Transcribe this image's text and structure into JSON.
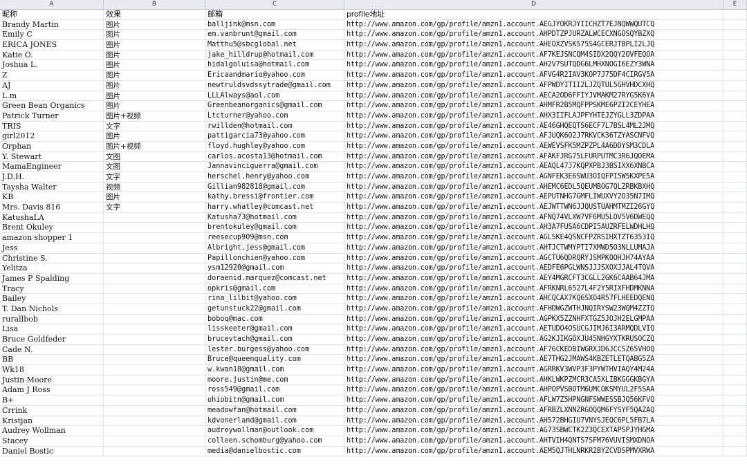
{
  "column_letters": [
    "A",
    "B",
    "C",
    "D",
    "E"
  ],
  "header_row": {
    "nickname": "昵称",
    "effect": "效果",
    "email": "邮箱",
    "profile": "profile地址"
  },
  "rows": [
    {
      "name": "Brandy Martin",
      "effect": "图片",
      "email": "balljink@msn.com",
      "profile": "http://www.amazon.com/gp/profile/amzn1.account.AEGJYOKRJYIICHZT7EJNQWWQUTCQ"
    },
    {
      "name": "Emily C",
      "effect": "图片",
      "email": "em.vanbrunt@gmail.com",
      "profile": "http://www.amazon.com/gp/profile/amzn1.account.AHPDTZPJURZALWCECXNGOSQYBZXQ"
    },
    {
      "name": "ERICA JONES",
      "effect": "图片",
      "email": "Matthu5@sbcglobal.net",
      "profile": "http://www.amazon.com/gp/profile/amzn1.account.AHEOXZVSK575S4GCERJTBPLI2LJQ"
    },
    {
      "name": "Katie O.",
      "effect": "图片",
      "email": "jake_hilldrup@hotmail.com",
      "profile": "http://www.amazon.com/gp/profile/amzn1.account.AF7KEJSNCQM4SIDX2QQY2OVFEQOA"
    },
    {
      "name": "Joshua L.",
      "effect": "图片",
      "email": "hidalgoluisa@hotmail.com",
      "profile": "http://www.amazon.com/gp/profile/amzn1.account.AH2V7SUTQDG6LMHXNOGI6EZY3WNA"
    },
    {
      "name": "Z",
      "effect": "图片",
      "email": "Ericaandmario@yahoo.com",
      "profile": "http://www.amazon.com/gp/profile/amzn1.account.AFVG4R2IAV3KOP7J75DF4CIRGV5A"
    },
    {
      "name": "AJ",
      "effect": "图片",
      "email": "newtruldsvdssytrade@gmail.com",
      "profile": "http://www.amazon.com/gp/profile/amzn1.account.AFPWDYITII2LJZQTUL5GHVHDCXHQ"
    },
    {
      "name": "L.m",
      "effect": "图片",
      "email": "LLLAlways@aol.com",
      "profile": "http://www.amazon.com/gp/profile/amzn1.account.AECA2OD6FFIYJVMAKM27RYG5K6YA"
    },
    {
      "name": "Green Bean Organics",
      "effect": "图片",
      "email": "Greenbeanorganics@gmail.com",
      "profile": "http://www.amazon.com/gp/profile/amzn1.account.AHMFR2B5MQFPPSKME6PZI2CEYHEA"
    },
    {
      "name": "Patrick Turner",
      "effect": "图片+视频",
      "email": "Ltcturner@yahoo.com",
      "profile": "http://www.amazon.com/gp/profile/amzn1.account.AHX3IIFLAJPFYHTEJZYGLL3ZDPAA"
    },
    {
      "name": "TRIS",
      "effect": "文字",
      "email": "rwillden@hotmail.com",
      "profile": "http://www.amazon.com/gp/profile/amzn1.account.AE46GHQEQTS6ECF7L7BSL4ML2JMQ"
    },
    {
      "name": "girl2012",
      "effect": "图片",
      "email": "pattigarcia73@yahoo.com",
      "profile": "http://www.amazon.com/gp/profile/amzn1.account.AFJUQK6O2J7RKVCK36TZYASCNFVQ"
    },
    {
      "name": "Orphan",
      "effect": "图片+视频",
      "email": "floyd.hughley@yahoo.com",
      "profile": "http://www.amazon.com/gp/profile/amzn1.account.AEWEVSFK5MZPZPL4A6DDYSM3CDLA"
    },
    {
      "name": "Y. Stewart",
      "effect": "文图",
      "email": "carlos.acosta13@hotmail.com",
      "profile": "http://www.amazon.com/gp/profile/amzn1.account.AFAKFJRG75LFURPUTMC3R6JQOEMA"
    },
    {
      "name": "MamaEngineer",
      "effect": "文图",
      "email": "Jannavinciguerra@gmail.com",
      "profile": "http://www.amazon.com/gp/profile/amzn1.account.AEAQL47J7KQPXPBJ3BSIXX6XNBCA"
    },
    {
      "name": "J.D.H.",
      "effect": "文字",
      "email": "herschel.henry@yahoo.com",
      "profile": "http://www.amazon.com/gp/profile/amzn1.account.AGNFEK3E6SWU3OIQFPI5W5KXPE5A"
    },
    {
      "name": "Taysha Walter",
      "effect": "视频",
      "email": "Gillian982818@gmail.com",
      "profile": "http://www.amazon.com/gp/profile/amzn1.account.AHEMC6EDL5QEUMBOG7QLZRBKBXHQ"
    },
    {
      "name": "KB",
      "effect": "图片",
      "email": "kathy.bressi@frontier.com",
      "profile": "http://www.amazon.com/gp/profile/amzn1.account.AEPUTNHG7GMFLIWUXVY2O35N7IMQ"
    },
    {
      "name": "Mrs. Davis 816",
      "effect": "文字",
      "email": "harry.whatley@comcast.net",
      "profile": "http://www.amazon.com/gp/profile/amzn1.account.AEJWTTWN6JJQUSTUAHMTMZI26GYQ"
    },
    {
      "name": "KatushaLA",
      "effect": "",
      "email": "Katusha73@hotmail.com",
      "profile": "http://www.amazon.com/gp/profile/amzn1.account.AFNQ74VLXW7VF6MU5LOV5V6DWEQQ"
    },
    {
      "name": "Brent Okuley",
      "effect": "",
      "email": "brentokuley@gmail.com",
      "profile": "http://www.amazon.com/gp/profile/amzn1.account.AH3A7FUSA6CDPI5AUZRFELWDHLHQ"
    },
    {
      "name": "amazon shopper 1",
      "effect": "",
      "email": "reesecup909@msn.com",
      "profile": "http://www.amazon.com/gp/profile/amzn1.account.AGLSKE4QSNCFPZRSIHXTZT6353IQ"
    },
    {
      "name": "Jess",
      "effect": "",
      "email": "Albright.jess@gmail.com",
      "profile": "http://www.amazon.com/gp/profile/amzn1.account.AHTJCTWMYPTI7XMWD5O3NLLUMAJA"
    },
    {
      "name": "Christine S.",
      "effect": "",
      "email": "Papillonchien@yahoo.com",
      "profile": "http://www.amazon.com/gp/profile/amzn1.account.AGCTU6QDRQRYJSMPKOOHJH74AYAA"
    },
    {
      "name": "Yelitza",
      "effect": "",
      "email": "ysm12920@gmail.com",
      "profile": "http://www.amazon.com/gp/profile/amzn1.account.AEDFE6PGLWNSJJJSXOXJJAL4TQVA"
    },
    {
      "name": "James P Spalding",
      "effect": "",
      "email": "doraenid.marquez@comcast.net",
      "profile": "http://www.amazon.com/gp/profile/amzn1.account.AEY4MGRCFT3CGLL2GK6CAAB64JMA"
    },
    {
      "name": "Tracy",
      "effect": "",
      "email": "opkris@gmail.com",
      "profile": "http://www.amazon.com/gp/profile/amzn1.account.AFRKNRL6527L4F2Y5RIXFHDMKNNA"
    },
    {
      "name": "Bailey",
      "effect": "",
      "email": "rina_lilbit@yahoo.com",
      "profile": "http://www.amazon.com/gp/profile/amzn1.account.AHCQCAX7KQ6SXO4R57FLHEEDQENQ"
    },
    {
      "name": "T. Dan Nichols",
      "effect": "",
      "email": "getunstuck22@gmail.com",
      "profile": "http://www.amazon.com/gp/profile/amzn1.account.AFHDWGZWTHJNQIRYSW23WQM4ZZTQ"
    },
    {
      "name": "rurallbob",
      "effect": "",
      "email": "boboq@mac.com",
      "profile": "http://www.amazon.com/gp/profile/amzn1.account.AGPKX5ZZNHFXTGZ5JOJH2ELGMPAA"
    },
    {
      "name": "Lisa",
      "effect": "",
      "email": "lisskeeter@gmail.com",
      "profile": "http://www.amazon.com/gp/profile/amzn1.account.AETUDO4OSUCGJIMJ6I3ARMQDLVIQ"
    },
    {
      "name": "Bruce Goldfeder",
      "effect": "",
      "email": "brucevtach@gmail.com",
      "profile": "http://www.amazon.com/gp/profile/amzn1.account.AG2KJIKGOXJU45NHGYXTKRUSOCZQ"
    },
    {
      "name": "Cade N.",
      "effect": "",
      "email": "lester.burgess@yahoo.com",
      "profile": "http://www.amazon.com/gp/profile/amzn1.account.AF76CKEDBIWGRXJD6JCCSZ65VHOQ"
    },
    {
      "name": "BB",
      "effect": "",
      "email": "Bruce@queenquality.com",
      "profile": "http://www.amazon.com/gp/profile/amzn1.account.AE7THG2JMAWS4KBZETLETQABG5ZA"
    },
    {
      "name": "Wk18",
      "effect": "",
      "email": "w.kwan18@gmail.com",
      "profile": "http://www.amazon.com/gp/profile/amzn1.account.AGRRKV3WVP3F3PYWTHVIAQY4M24A"
    },
    {
      "name": "Justin Moore",
      "effect": "",
      "email": "moore.justin@me.com",
      "profile": "http://www.amazon.com/gp/profile/amzn1.account.AHKLWKPZMCR3CA5XLIBKGGGKBGYA"
    },
    {
      "name": "Adam J Ross",
      "effect": "",
      "email": "ross549@gmail.com",
      "profile": "http://www.amazon.com/gp/profile/amzn1.account.AHPOPVSBOTM6UMCOKSMYUL2F5SAA"
    },
    {
      "name": "B+",
      "effect": "",
      "email": "ohiobitn@gmail.com",
      "profile": "http://www.amazon.com/gp/profile/amzn1.account.AFLW7Z5HPNGNFSWWESSBJQ56KFVQ"
    },
    {
      "name": "Crrink",
      "effect": "",
      "email": "meadowfan@hotmail.com",
      "profile": "http://www.amazon.com/gp/profile/amzn1.account.AFRBZLXNNZRGOQQM6FYSYF5QAZAQ"
    },
    {
      "name": "Kristjan",
      "effect": "",
      "email": "kdvonerland@gmail.com",
      "profile": "http://www.amazon.com/gp/profile/amzn1.account.AH572BHGIU7VNYSJEQC6PL5FB7LA"
    },
    {
      "name": "Audrey Wollman",
      "effect": "",
      "email": "audreywollman@outlook.com",
      "profile": "http://www.amazon.com/gp/profile/amzn1.account.AG73SBWCTK2Z3QCEXTAPSPJYHGMA"
    },
    {
      "name": "Stacey",
      "effect": "",
      "email": "colleen.schomburg@yahoo.com",
      "profile": "http://www.amazon.com/gp/profile/amzn1.account.AHTVIH4QNTS7SFM76VUVISMXDNOA"
    },
    {
      "name": "Daniel Bostic",
      "effect": "",
      "email": "media@danielbostic.com",
      "profile": "http://www.amazon.com/gp/profile/amzn1.account.AEM5QJTHLNRKR2BYZCVDSPMVXRWA"
    }
  ]
}
